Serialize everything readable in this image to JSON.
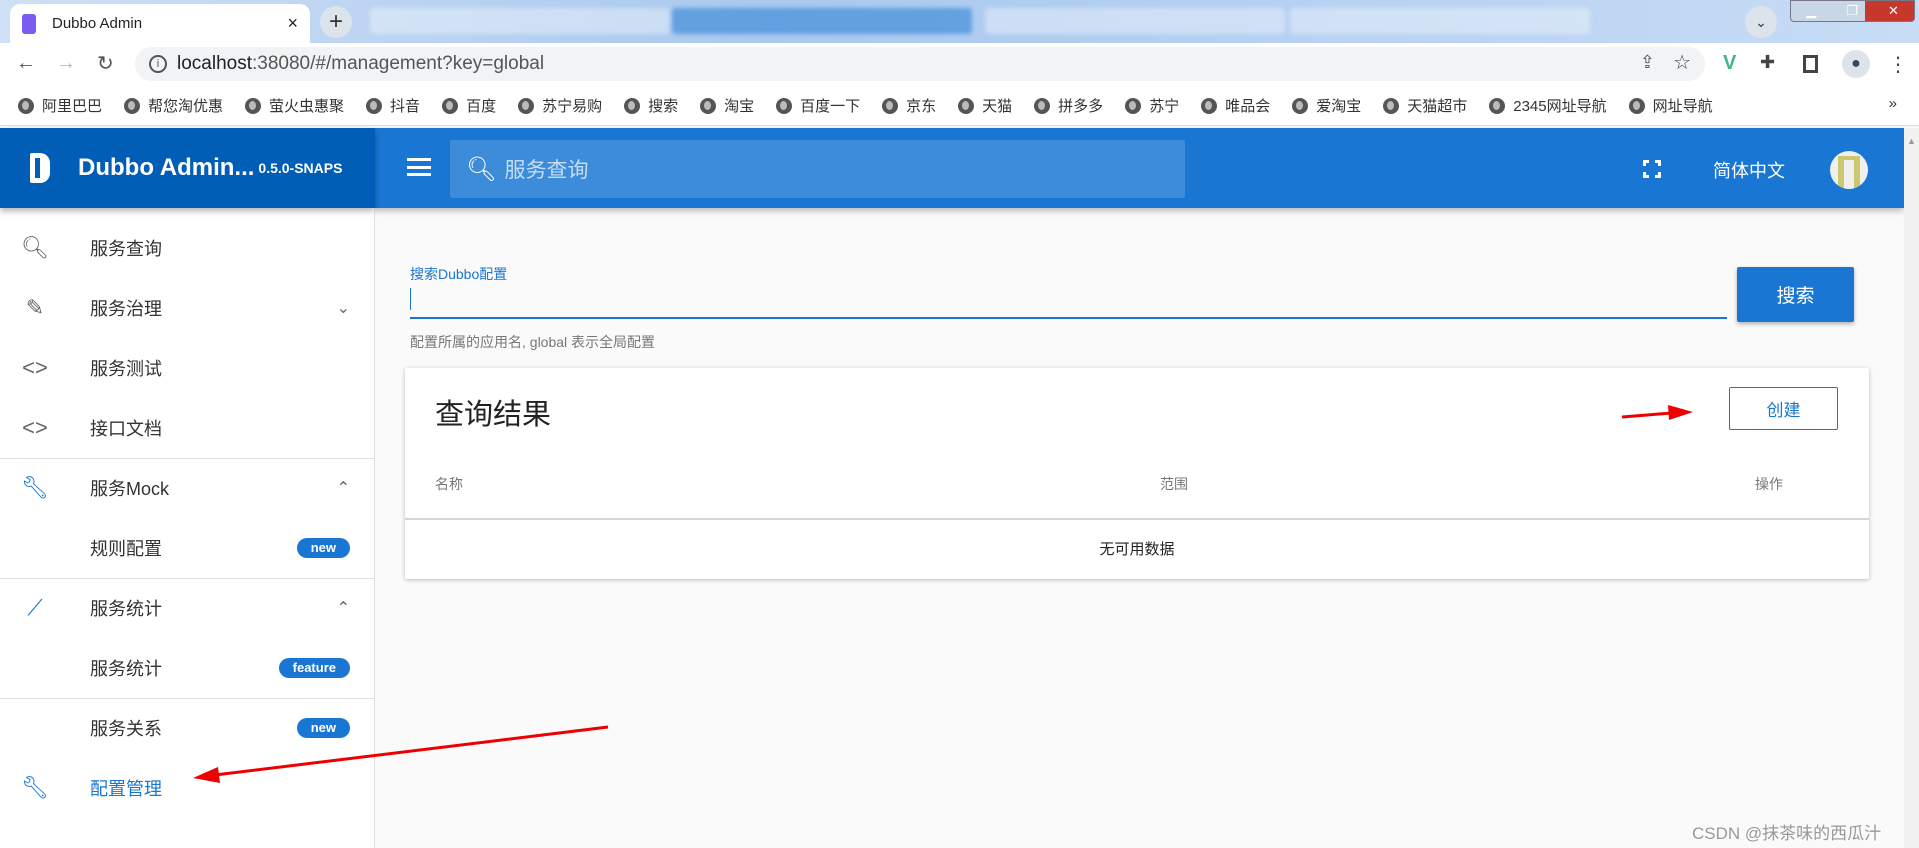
{
  "browser": {
    "active_tab_title": "Dubbo Admin",
    "url_host": "localhost",
    "url_rest": ":38080/#/management?key=global",
    "bookmarks": [
      "阿里巴巴",
      "帮您淘优惠",
      "萤火虫惠聚",
      "抖音",
      "百度",
      "苏宁易购",
      "搜索",
      "淘宝",
      "百度一下",
      "京东",
      "天猫",
      "拼多多",
      "苏宁",
      "唯品会",
      "爱淘宝",
      "天猫超市",
      "2345网址导航",
      "网址导航"
    ],
    "bookmarks_more": "»"
  },
  "app": {
    "title": "Dubbo Admin...",
    "version": "0.5.0-SNAPS",
    "search_placeholder": "服务查询",
    "language": "简体中文",
    "accent": "#1976d2"
  },
  "sidebar": {
    "items": [
      {
        "label": "服务查询",
        "icon": "search-icon"
      },
      {
        "label": "服务治理",
        "icon": "pencil-icon"
      },
      {
        "label": "服务测试",
        "icon": "code-icon"
      },
      {
        "label": "接口文档",
        "icon": "code-icon"
      },
      {
        "label": "服务Mock",
        "icon": "wrench-icon"
      },
      {
        "label": "规则配置",
        "badge": "new"
      },
      {
        "label": "服务统计",
        "icon": "trending-icon"
      },
      {
        "label": "服务统计",
        "badge": "feature"
      },
      {
        "label": "服务关系",
        "badge": "new"
      },
      {
        "label": "配置管理",
        "icon": "wrench-icon"
      }
    ]
  },
  "main": {
    "search_label": "搜索Dubbo配置",
    "search_value": "",
    "search_hint": "配置所属的应用名, global 表示全局配置",
    "search_button": "搜索",
    "card_title": "查询结果",
    "create_button": "创建",
    "columns": [
      "名称",
      "范围",
      "操作"
    ],
    "empty_text": "无可用数据"
  },
  "watermark": "CSDN @抹茶味的西瓜汁"
}
